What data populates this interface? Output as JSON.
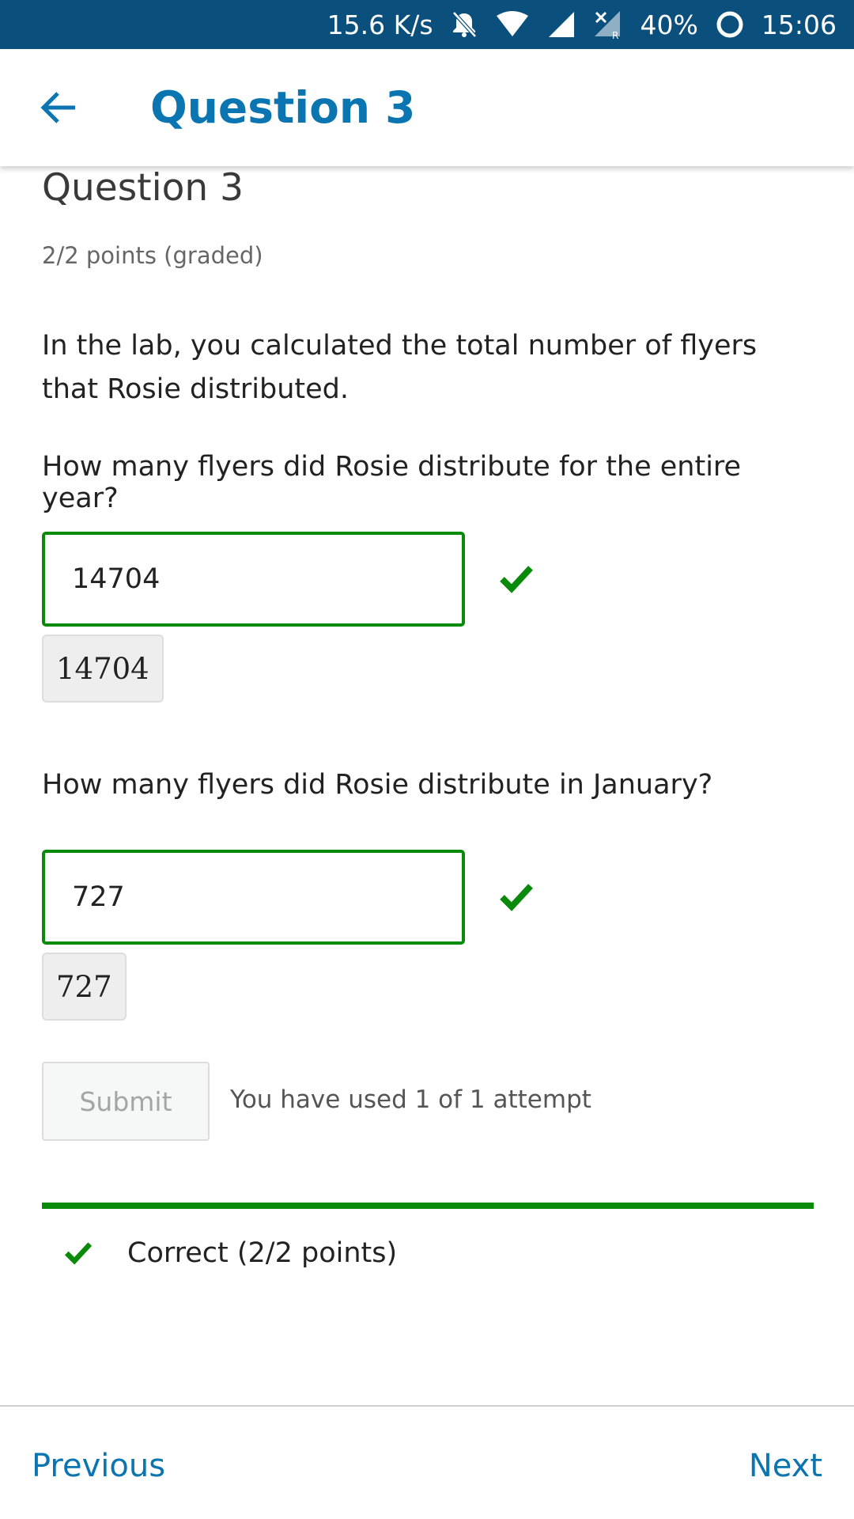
{
  "status_bar": {
    "network_speed": "15.6 K/s",
    "battery": "40%",
    "time": "15:06",
    "icons": [
      "notifications-off-icon",
      "wifi-icon",
      "signal-icon",
      "no-signal-roaming-icon",
      "battery-ring-icon"
    ]
  },
  "app_bar": {
    "title": "Question 3",
    "back_icon": "arrow-left-icon"
  },
  "question": {
    "heading": "Question 3",
    "points": "2/2 points (graded)",
    "intro": "In the lab, you calculated the total number of flyers that Rosie distributed.",
    "parts": [
      {
        "prompt": "How many flyers did Rosie distribute for the entire year?",
        "answer": "14704",
        "preview": "14704",
        "status": "correct"
      },
      {
        "prompt": "How many flyers did Rosie distribute in January?",
        "answer": "727",
        "preview": "727",
        "status": "correct"
      }
    ],
    "submit_label": "Submit",
    "attempts_text": "You have used 1 of 1 attempt",
    "result_text": "Correct (2/2 points)"
  },
  "bottom_nav": {
    "previous_label": "Previous",
    "next_label": "Next"
  },
  "colors": {
    "status_bar_bg": "#0b4f7c",
    "accent_blue": "#0a75b0",
    "correct_green": "#0a8a0a"
  }
}
